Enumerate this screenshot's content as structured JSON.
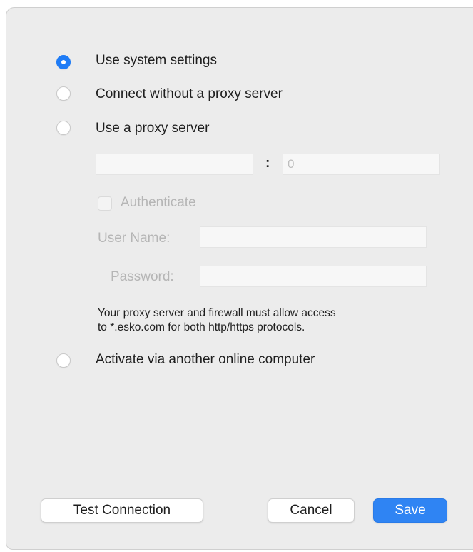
{
  "options": {
    "system_settings": "Use system settings",
    "no_proxy": "Connect without a proxy server",
    "use_proxy": "Use a proxy server",
    "other_computer": "Activate via another online computer"
  },
  "selected_option": "system_settings",
  "proxy": {
    "host_value": "",
    "port_separator": ":",
    "port_placeholder": "0",
    "authenticate_label": "Authenticate",
    "username_label": "User Name:",
    "password_label": "Password:"
  },
  "note": {
    "line1": "Your proxy server and firewall must allow access",
    "line2": "to *.esko.com for both http/https protocols."
  },
  "buttons": {
    "test_connection": "Test Connection",
    "cancel": "Cancel",
    "save": "Save"
  },
  "colors": {
    "accent": "#1f7cf6",
    "dialog_bg": "#ececec"
  }
}
